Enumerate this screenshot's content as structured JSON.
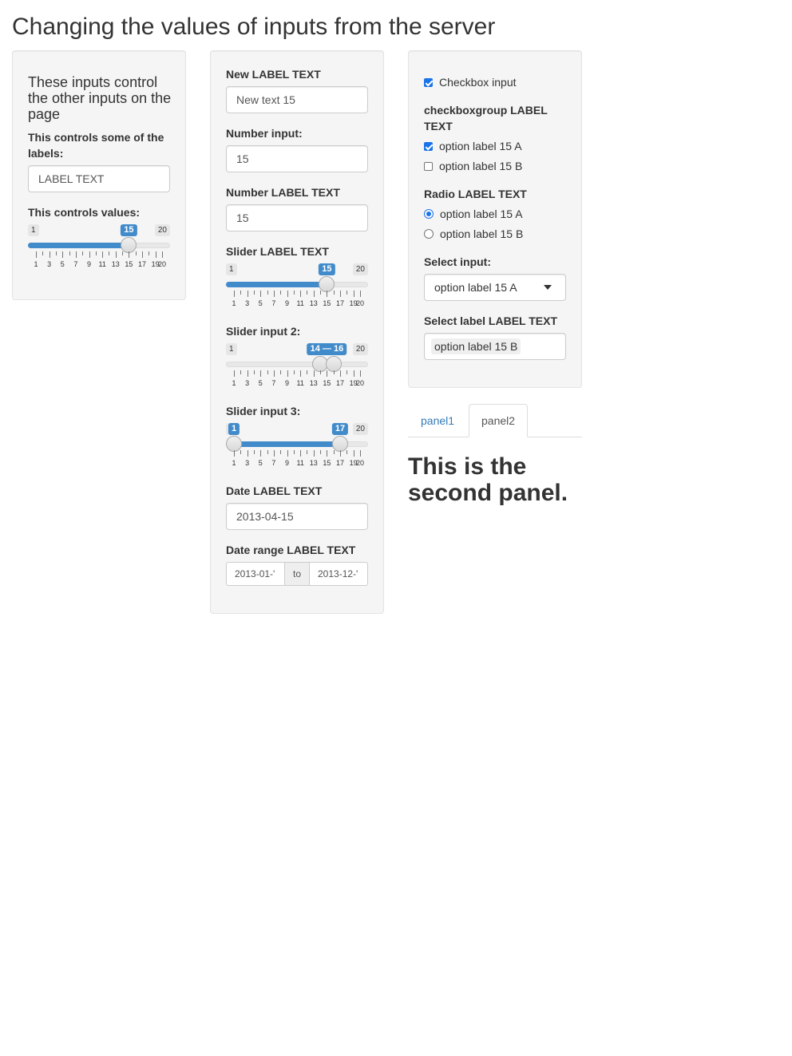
{
  "page_title": "Changing the values of inputs from the server",
  "control_panel": {
    "heading": "These inputs control the other inputs on the page",
    "label_control_label": "This controls some of the labels:",
    "label_control_value": "LABEL TEXT",
    "value_control_label": "This controls values:",
    "value_slider": {
      "min": 1,
      "max": 20,
      "value": 15,
      "min_label": "1",
      "max_label": "20",
      "value_label": "15",
      "tick_labels": [
        "1",
        "3",
        "5",
        "7",
        "9",
        "11",
        "13",
        "15",
        "17",
        "19",
        "20"
      ]
    }
  },
  "middle_panel": {
    "text_label": "New LABEL TEXT",
    "text_value": "New text 15",
    "number_label": "Number input:",
    "number_value": "15",
    "number2_label": "Number LABEL TEXT",
    "number2_value": "15",
    "slider_label": "Slider LABEL TEXT",
    "slider": {
      "min": 1,
      "max": 20,
      "value": 15,
      "min_label": "1",
      "max_label": "20",
      "value_label": "15"
    },
    "slider2_label": "Slider input 2:",
    "slider2": {
      "min": 1,
      "max": 20,
      "from": 14,
      "to": 16,
      "min_label": "1",
      "max_label": "20",
      "value_label": "14 — 16"
    },
    "slider3_label": "Slider input 3:",
    "slider3": {
      "min": 1,
      "max": 20,
      "from": 1,
      "to": 17,
      "min_label": "1",
      "max_label": "20",
      "from_label": "1",
      "to_label": "17"
    },
    "date_label": "Date LABEL TEXT",
    "date_value": "2013-04-15",
    "daterange_label": "Date range LABEL TEXT",
    "daterange_start": "2013-01-'",
    "daterange_sep": "to",
    "daterange_end": "2013-12-'"
  },
  "right_panel": {
    "checkbox_label": "Checkbox input",
    "checkbox_checked": true,
    "cbgroup_label": "checkboxgroup LABEL TEXT",
    "cbgroup_options": [
      {
        "label": "option label 15 A",
        "checked": true
      },
      {
        "label": "option label 15 B",
        "checked": false
      }
    ],
    "radio_label": "Radio LABEL TEXT",
    "radio_options": [
      {
        "label": "option label 15 A",
        "selected": true
      },
      {
        "label": "option label 15 B",
        "selected": false
      }
    ],
    "select_label": "Select input:",
    "select_value": "option label 15 A",
    "select2_label": "Select label LABEL TEXT",
    "select2_value": "option label 15 B"
  },
  "tabs": {
    "items": [
      {
        "label": "panel1",
        "active": false
      },
      {
        "label": "panel2",
        "active": true
      }
    ],
    "active_content": "This is the second panel."
  },
  "colors": {
    "accent": "#428bca",
    "link": "#337ab7",
    "check": "#1a73e8"
  }
}
